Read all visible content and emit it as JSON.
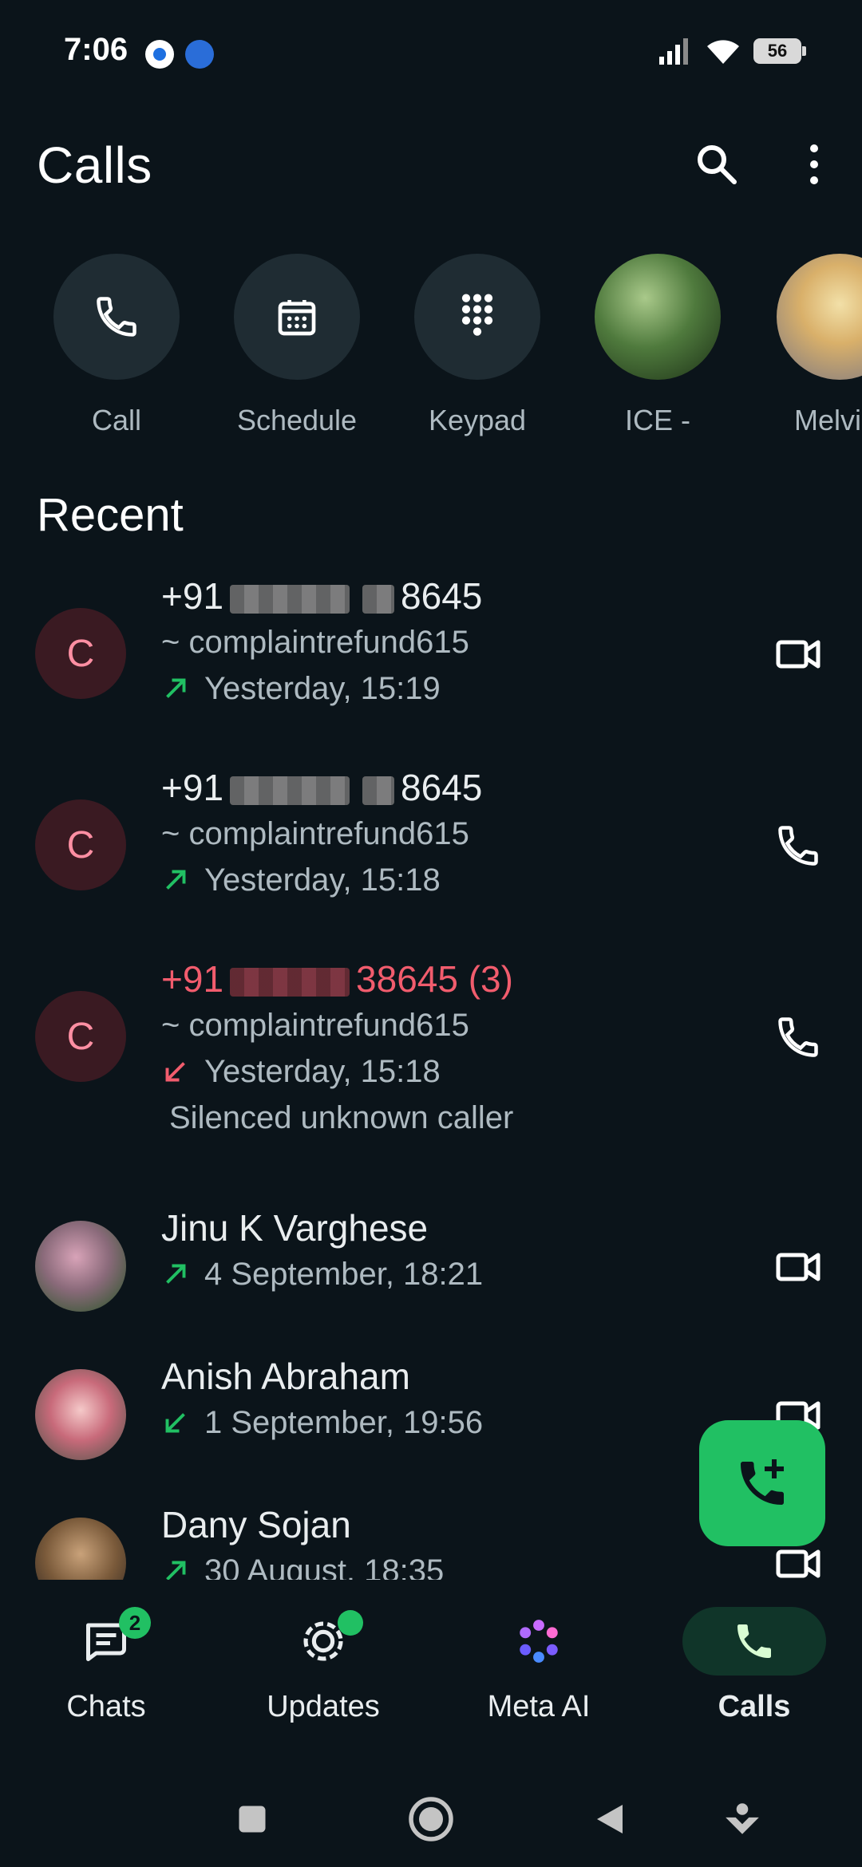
{
  "status_bar": {
    "time": "7:06",
    "battery": "56"
  },
  "header": {
    "title": "Calls"
  },
  "quick_actions": [
    {
      "label": "Call"
    },
    {
      "label": "Schedule"
    },
    {
      "label": "Keypad"
    },
    {
      "label": "ICE -"
    },
    {
      "label": "Melvi"
    }
  ],
  "recent": {
    "title": "Recent",
    "calls": [
      {
        "avatar_letter": "C",
        "name_prefix": "+91",
        "name_suffix": "8645",
        "subtitle": "~ complaintrefund615",
        "time": "Yesterday, 15:19",
        "direction": "outgoing"
      },
      {
        "avatar_letter": "C",
        "name_prefix": "+91",
        "name_suffix": "8645",
        "subtitle": "~ complaintrefund615",
        "time": "Yesterday, 15:18",
        "direction": "outgoing"
      },
      {
        "avatar_letter": "C",
        "name_prefix": "+91",
        "name_suffix": "38645",
        "count": "(3)",
        "subtitle": "~ complaintrefund615",
        "time": "Yesterday, 15:18",
        "extra": "Silenced unknown caller",
        "direction": "missed"
      },
      {
        "name": "Jinu K Varghese",
        "time": "4 September, 18:21",
        "direction": "outgoing"
      },
      {
        "name": "Anish Abraham",
        "time": "1 September, 19:56",
        "direction": "incoming"
      },
      {
        "name": "Dany Sojan",
        "time": "30 August, 18:35",
        "direction": "outgoing"
      }
    ]
  },
  "bottom_nav": {
    "chats": {
      "label": "Chats",
      "badge": "2"
    },
    "updates": {
      "label": "Updates"
    },
    "meta_ai": {
      "label": "Meta AI"
    },
    "calls": {
      "label": "Calls"
    }
  },
  "colors": {
    "background": "#0b141a",
    "accent_green": "#21c063",
    "missed_red": "#f15c6d",
    "surface": "#1f2c33"
  }
}
